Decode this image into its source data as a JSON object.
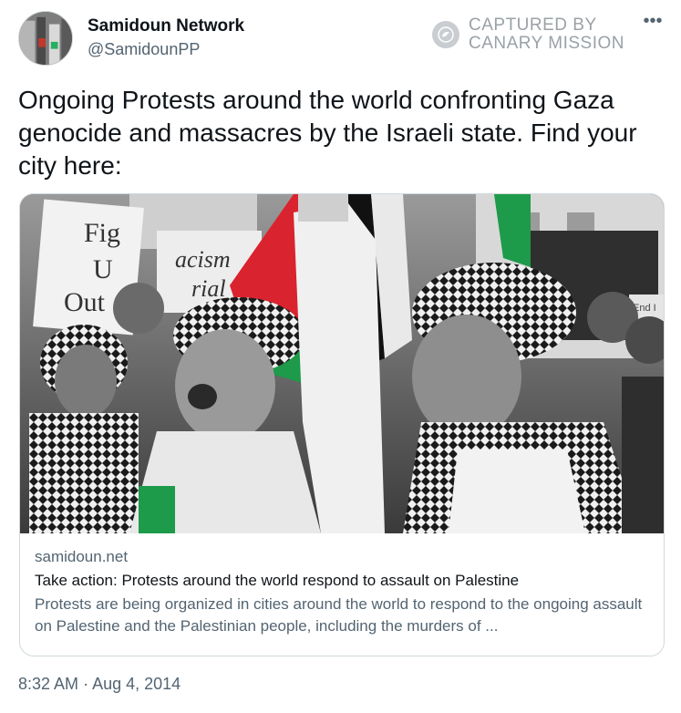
{
  "author": {
    "display_name": "Samidoun Network",
    "handle": "@SamidounPP"
  },
  "watermark": {
    "line1": "CAPTURED BY",
    "line2": "CANARY MISSION",
    "icon": "canary-bird-icon"
  },
  "more_icon": "more-options-icon",
  "tweet": {
    "text": "Ongoing Protests around the world confronting Gaza genocide and massacres by the Israeli state. Find your city here:"
  },
  "card": {
    "image_sign_left": [
      "Fig",
      "U",
      "Out"
    ],
    "image_sign_right": [
      "acism",
      "rial"
    ],
    "image_sign_far_right": "End I",
    "domain": "samidoun.net",
    "title": "Take action: Protests around the world respond to assault on Palestine",
    "description": "Protests are being organized in cities around the world to respond to the ongoing assault on Palestine and the Palestinian people, including the murders of ..."
  },
  "meta": {
    "time": "8:32 AM",
    "separator": "·",
    "date": "Aug 4, 2014"
  },
  "colors": {
    "text_primary": "#0f1419",
    "text_secondary": "#536471",
    "border": "#cfd9de",
    "watermark": "#9aa1a7",
    "flag_red": "#d9232e",
    "flag_green": "#1d9a4a"
  }
}
